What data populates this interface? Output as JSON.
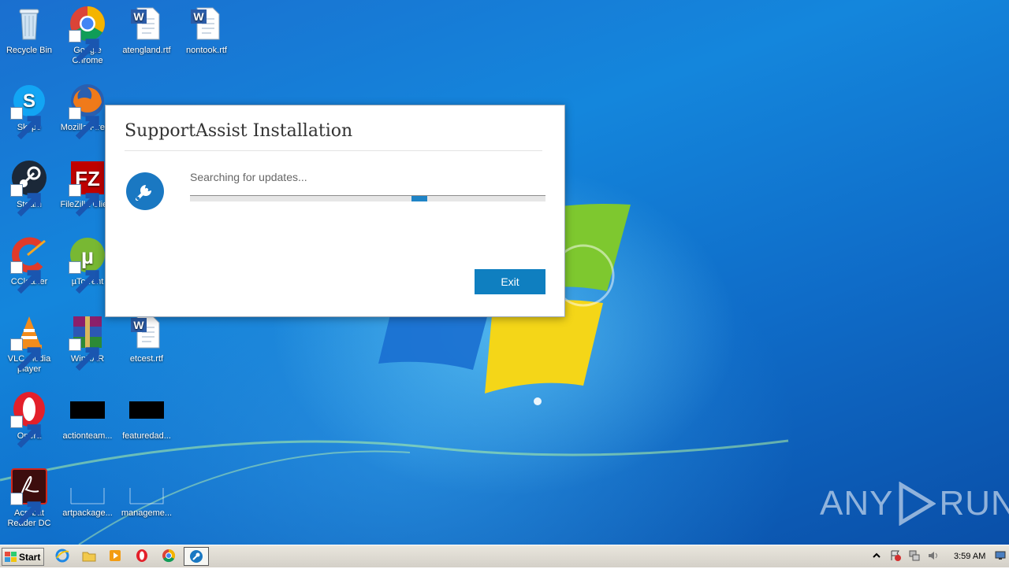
{
  "desktop": {
    "icons": [
      {
        "label": "Recycle Bin"
      },
      {
        "label": "Google Chrome"
      },
      {
        "label": "atengland.rtf"
      },
      {
        "label": "nontook.rtf"
      },
      {
        "label": "Skype"
      },
      {
        "label": "Mozilla Firef..."
      },
      {
        "label": "Steam"
      },
      {
        "label": "FileZilla Clie..."
      },
      {
        "label": "CCleaner"
      },
      {
        "label": "µTorrent"
      },
      {
        "label": "VLC media player"
      },
      {
        "label": "WinRAR"
      },
      {
        "label": "etcest.rtf"
      },
      {
        "label": "Opera"
      },
      {
        "label": "actionteam..."
      },
      {
        "label": "featuredad..."
      },
      {
        "label": "Acrobat Reader DC"
      },
      {
        "label": "artpackage..."
      },
      {
        "label": "manageme..."
      }
    ]
  },
  "dialog": {
    "title": "SupportAssist Installation",
    "status": "Searching for updates...",
    "progress_percent": 63,
    "exit_label": "Exit"
  },
  "watermark": {
    "left": "ANY",
    "right": "RUN"
  },
  "taskbar": {
    "start_label": "Start",
    "clock": "3:59 AM"
  },
  "colors": {
    "accent": "#0f7fc0",
    "desktop": "#1486dc"
  }
}
